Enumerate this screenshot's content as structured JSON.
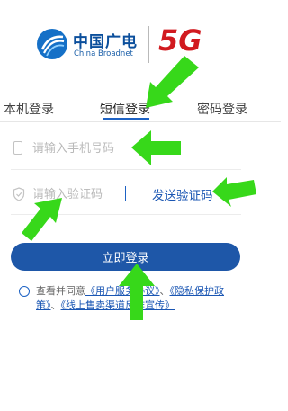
{
  "brand": {
    "name_cn": "中国广电",
    "name_en": "China Broadnet",
    "logo_5g": "5G",
    "colors": {
      "primary": "#1e57a8",
      "accent_red": "#d11a1f",
      "annotation_green": "#37d81a"
    }
  },
  "tabs": [
    {
      "label": "本机登录"
    },
    {
      "label": "短信登录",
      "active": true
    },
    {
      "label": "密码登录"
    }
  ],
  "form": {
    "phone": {
      "placeholder": "请输入手机号码",
      "value": "",
      "icon": "phone-icon"
    },
    "code": {
      "placeholder": "请输入验证码",
      "value": "",
      "icon": "shield-icon"
    },
    "send_code_label": "发送验证码"
  },
  "login_button": {
    "label": "立即登录"
  },
  "agreement": {
    "prefix": "查看并同意",
    "link1": "《用户服务协议》",
    "sep1": "、",
    "link2": "《隐私保护政策》",
    "sep2": "、",
    "link3": "《线上售卖渠道反诈宣传》",
    "checked": false
  }
}
